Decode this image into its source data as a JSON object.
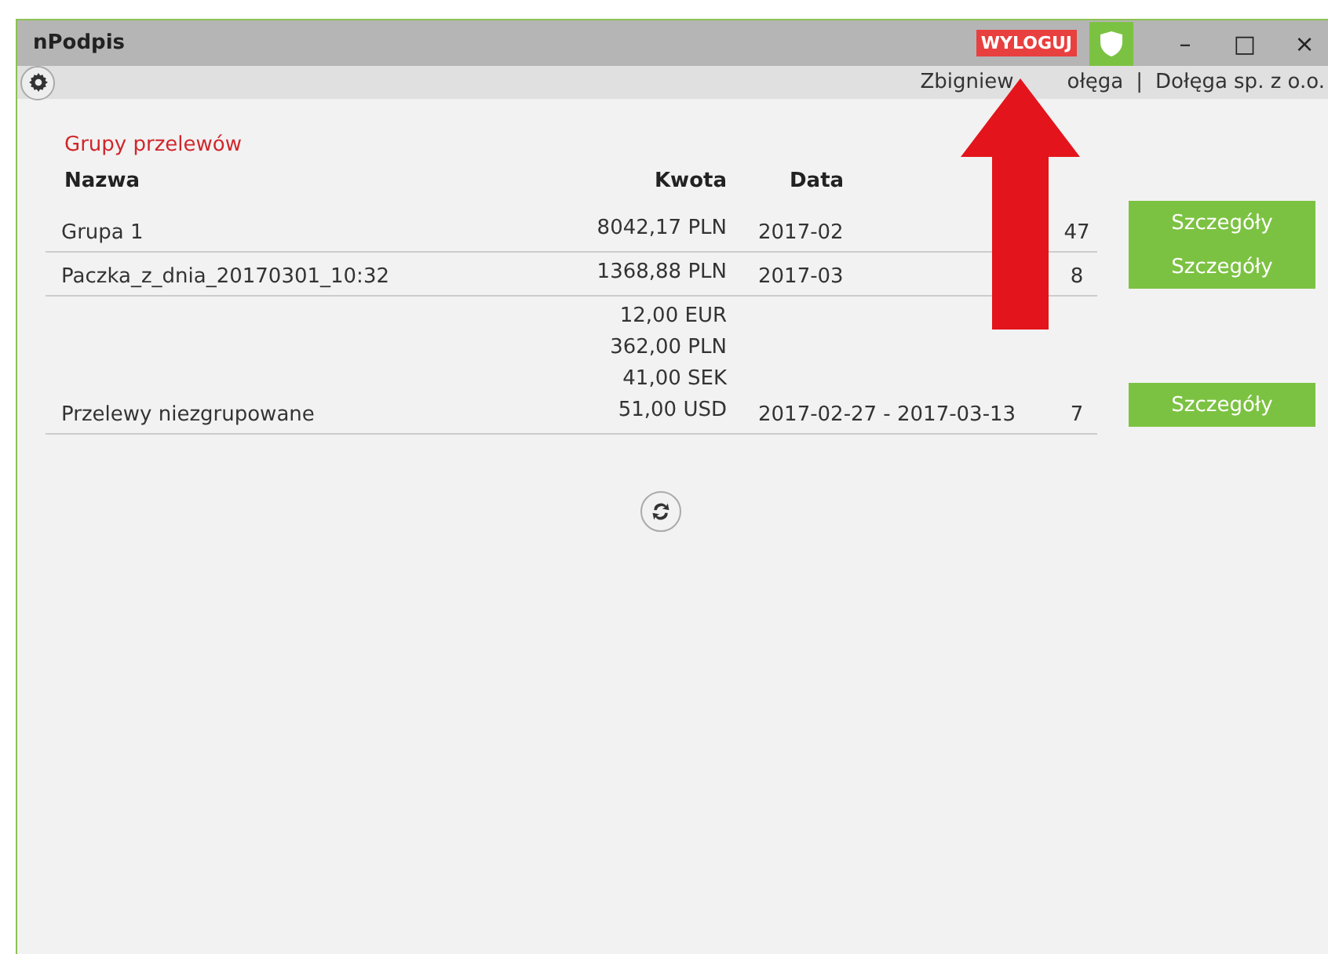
{
  "window": {
    "title": "nPodpis",
    "logout_button": "WYLOGUJ",
    "minimize": "–",
    "maximize": "□",
    "close": "×"
  },
  "toolbar": {
    "user_parts": [
      "Zbigniew",
      "ołęga"
    ],
    "separator": "|",
    "company": "Dołęga sp. z o.o."
  },
  "section_title": "Grupy przelewów",
  "table": {
    "columns": [
      "Nazwa",
      "Kwota",
      "Data"
    ],
    "rows": [
      {
        "name": "Grupa 1",
        "amounts": [
          "8042,17 PLN"
        ],
        "date": "2017-02",
        "count": "47",
        "button": "Szczegóły"
      },
      {
        "name": "Paczka_z_dnia_20170301_10:32",
        "amounts": [
          "1368,88 PLN"
        ],
        "date": "2017-03",
        "count": "8",
        "button": "Szczegóły"
      },
      {
        "name": "Przelewy niezgrupowane",
        "amounts": [
          "12,00 EUR",
          "362,00 PLN",
          "41,00 SEK",
          "51,00 USD"
        ],
        "date": "2017-02-27 - 2017-03-13",
        "count": "7",
        "button": "Szczegóły"
      }
    ]
  }
}
